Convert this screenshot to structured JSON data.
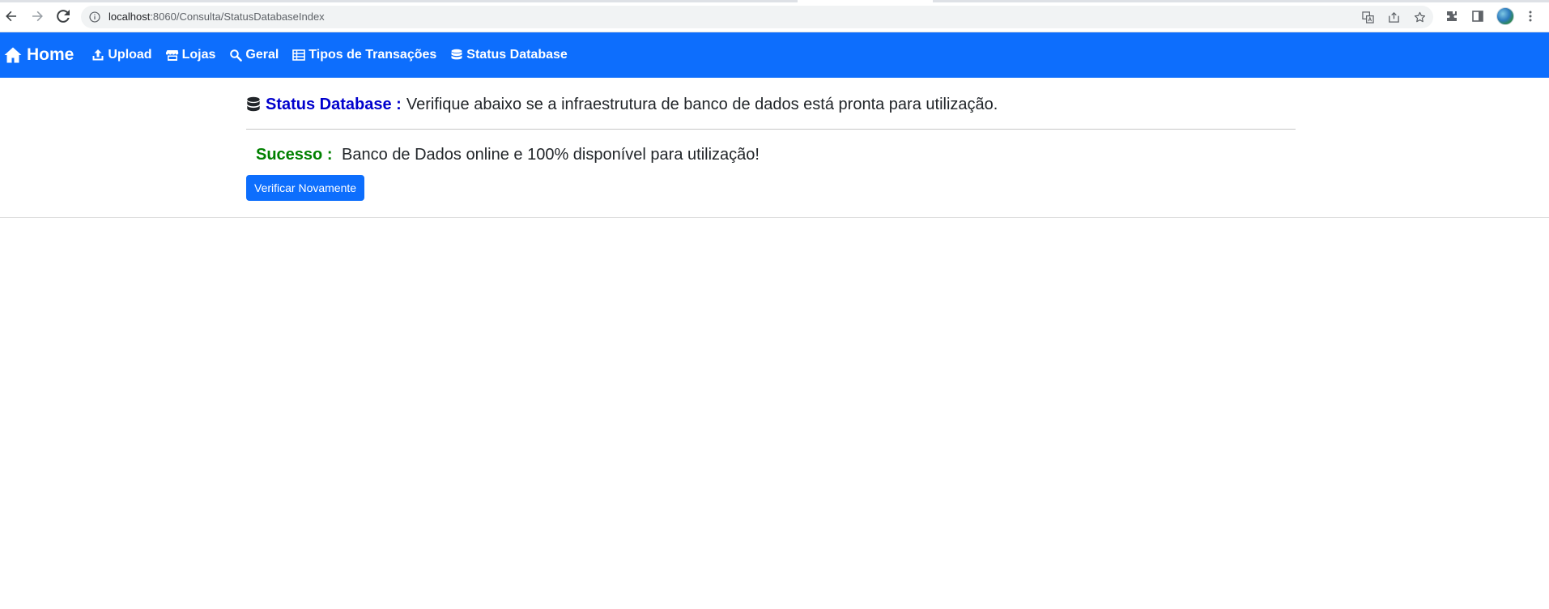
{
  "browser": {
    "url_host": "localhost",
    "url_rest": ":8060/Consulta/StatusDatabaseIndex"
  },
  "navbar": {
    "brand_label": "Home",
    "brand_icon": "home-icon",
    "links": [
      {
        "label": "Upload",
        "icon": "upload-icon"
      },
      {
        "label": "Lojas",
        "icon": "store-icon"
      },
      {
        "label": "Geral",
        "icon": "search-icon"
      },
      {
        "label": "Tipos de Transações",
        "icon": "table-icon"
      },
      {
        "label": "Status Database",
        "icon": "database-icon"
      }
    ],
    "background_color": "#0d6efd"
  },
  "main": {
    "heading_title": "Status Database :",
    "heading_text": "Verifique abaixo se a infraestrutura de banco de dados está pronta para utilização.",
    "status_label": "Sucesso :",
    "status_text": "Banco de Dados online e 100% disponível para utilização!",
    "button_label": "Verificar Novamente",
    "colors": {
      "heading_title": "#0000cd",
      "status_label": "#008000",
      "button": "#0d6efd"
    }
  }
}
